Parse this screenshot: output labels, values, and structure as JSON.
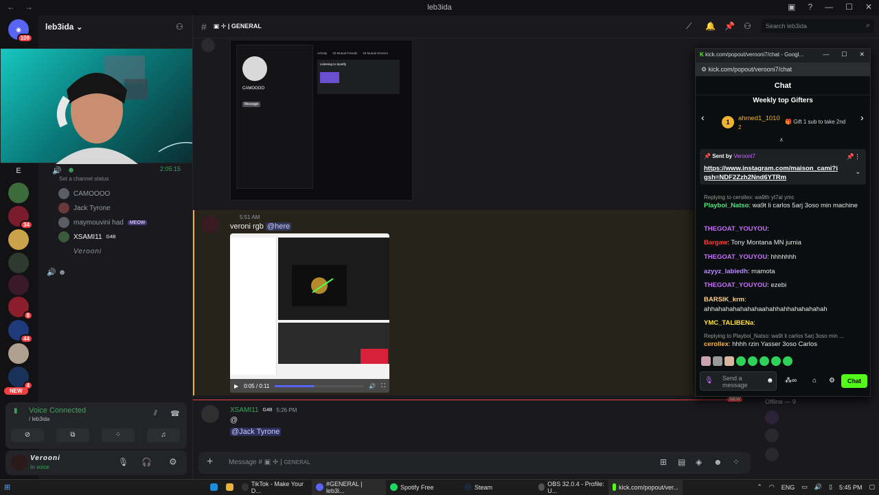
{
  "window": {
    "title": "leb3ida"
  },
  "server": {
    "name": "leb3ida",
    "badge": "109"
  },
  "rail_badges": [
    "34",
    "8",
    "44",
    "4"
  ],
  "rail_new_label": "NEW",
  "rail_e": "E",
  "webcam": {
    "timer": "2:05:15"
  },
  "voice": {
    "status_placeholder": "Set a channel status",
    "users": [
      "CAMOOOO",
      "Jack Tyrone",
      "maymouvini had",
      "XSAMI11",
      "Verooni"
    ],
    "meow_tag": "MEOW",
    "g4b_tag": "G4B"
  },
  "voice_panel": {
    "title": "Voice Connected",
    "sub": "/ leb3ida"
  },
  "user_panel": {
    "name": "Verooni",
    "status": "In voice"
  },
  "channel": {
    "name": "GENERAL",
    "search_placeholder": "Search leb3ida",
    "composer_placeholder": "Message #",
    "composer_channel": "GENERAL"
  },
  "shot1": {
    "name": "CAMOOOO",
    "tabs": [
      "Activity",
      "33 Mutual Friends",
      "33 Mutual Servers"
    ],
    "button": "Message",
    "label": "Listening to Spotify"
  },
  "messages": [
    {
      "time": "5:51 AM",
      "author": "veroni rgb",
      "mention": "@here",
      "video": {
        "time": "0:05 / 0:11"
      }
    },
    {
      "time": "5:26 PM",
      "author": "XSAMI11",
      "tag": "G4B",
      "line1": "@",
      "mention": "@Jack Tyrone"
    }
  ],
  "new_divider": "NEW",
  "members": {
    "offline": "Offline — 9"
  },
  "kick": {
    "tab_title": "kick.com/popout/verooni7/chat - Googl...",
    "url": "kick.com/popout/verooni7/chat",
    "header": "Chat",
    "gifters_title": "Weekly top Gifters",
    "top_gifter": {
      "name": "ahmed1_1010",
      "rank": "1",
      "count": "2"
    },
    "gift_cta": "Gift 1 sub to take 2nd",
    "pinned": {
      "sent_by": "Sent by",
      "user": "Verooni7",
      "link": "https://www.instagram.com/maison_cami?igsh=NDF2Zzh2Nnd6YTRm"
    },
    "chat": [
      {
        "reply": "Replying to cerollex: wa9th yt7al ymc"
      },
      {
        "user": "Playboi_Natso",
        "color": "#4ee87b",
        "text": ": wa9t li carlos 5arj 3oso min machine"
      },
      {
        "user": "THEGOAT_YOUYOU",
        "color": "#c86dff",
        "text": ":"
      },
      {
        "user": "Bargaw",
        "color": "#ff3b3b",
        "text": ": Tony Montana MN jumia"
      },
      {
        "user": "THEGOAT_YOUYOU",
        "color": "#c86dff",
        "text": ": hhhhhhh"
      },
      {
        "user": "azyyz_labiedh",
        "color": "#b98bff",
        "text": ": mamota"
      },
      {
        "user": "THEGOAT_YOUYOU",
        "color": "#c86dff",
        "text": ": ezebi"
      },
      {
        "user": "BARSIK_krm",
        "color": "#ffd08a",
        "text": ":"
      },
      {
        "text2": "ahhahahahahahahaahahhahhahahahahah"
      },
      {
        "user": "YMC_TALIBENa",
        "color": "#ffe14d",
        "text": ":"
      },
      {
        "reply": "Replying to Playboi_Natso: wa9t li carlos 5arj 3oso min ..."
      },
      {
        "user": "cerollex",
        "color": "#ffb347",
        "text": ": hhhh rzin Yasser 3oso Carlos"
      }
    ],
    "input_placeholder": "Send a message",
    "chat_button": "Chat"
  },
  "taskbar": {
    "items": [
      "TikTok - Make Your D...",
      "#GENERAL | leb3i...",
      "Spotify Free",
      "Steam",
      "OBS 32.0.4 - Profile: U...",
      "kick.com/popout/ver..."
    ],
    "lang": "ENG",
    "clock": "5:45 PM"
  }
}
